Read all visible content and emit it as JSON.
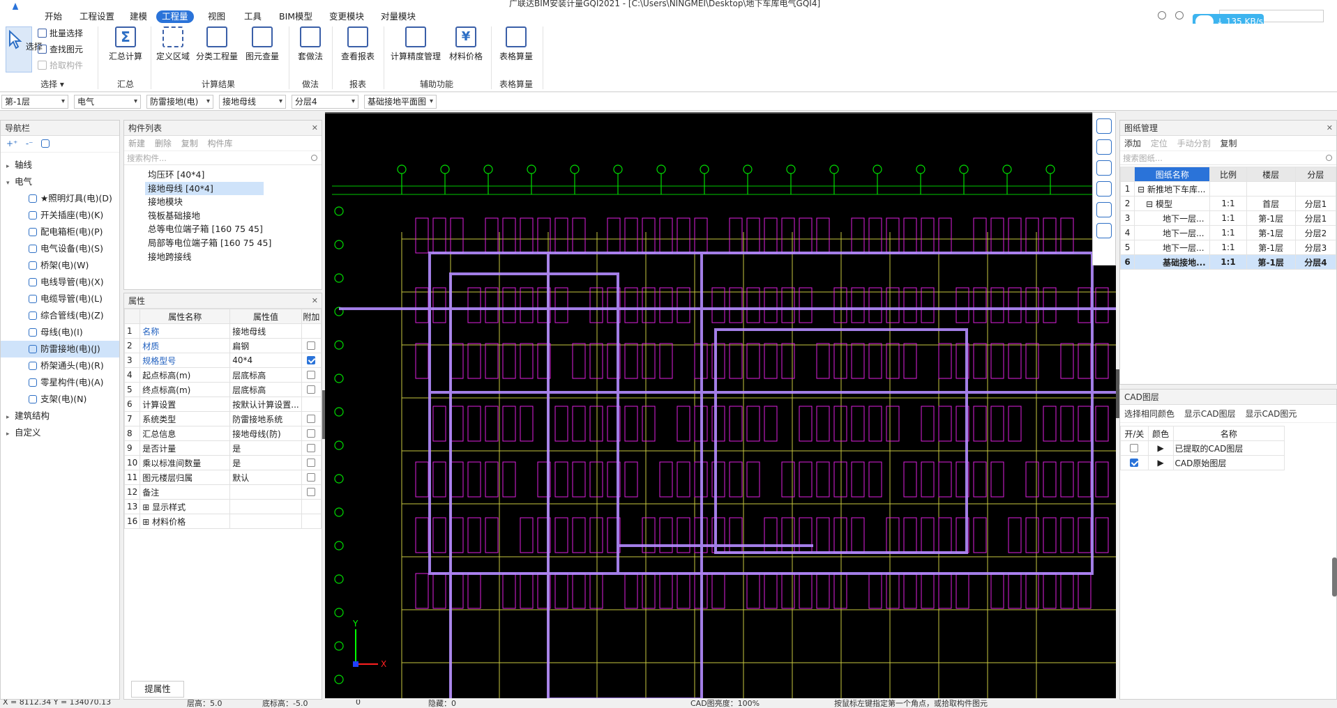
{
  "title": "广联达BIM安装计量GQI2021 - [C:\\Users\\NINGMEI\\Desktop\\地下车库电气GQI4]",
  "menus": [
    "开始",
    "工程设置",
    "建模",
    "工程量",
    "视图",
    "工具",
    "BIM模型",
    "变更模块",
    "对量模块"
  ],
  "active_menu": "工程量",
  "net_speed": "↓ 135 KB/s",
  "ribbon": {
    "select": "选择",
    "batch_select": "批量选择",
    "find_element": "查找图元",
    "pick_component": "拾取构件",
    "sum_calc": "汇总计算",
    "define_region": "定义区域",
    "sub_quantity": "分类工程量",
    "element_check": "图元查量",
    "apply_method": "套做法",
    "view_report": "查看报表",
    "precision_mgmt": "计算精度管理",
    "material_price": "材料价格",
    "table_calc": "表格算量",
    "groups": {
      "select": "选择",
      "summary": "汇总",
      "results": "计算结果",
      "method": "做法",
      "report": "报表",
      "aux": "辅助功能",
      "table": "表格算量"
    }
  },
  "selectors": [
    "第-1层",
    "电气",
    "防雷接地(电)",
    "接地母线",
    "分层4",
    "基础接地平面图"
  ],
  "nav": {
    "title": "导航栏",
    "items": [
      {
        "label": "轴线",
        "level": 0,
        "tri": "▸"
      },
      {
        "label": "电气",
        "level": 0,
        "tri": "▾"
      },
      {
        "label": "★照明灯具(电)(D)",
        "level": 1
      },
      {
        "label": "开关插座(电)(K)",
        "level": 1
      },
      {
        "label": "配电箱柜(电)(P)",
        "level": 1
      },
      {
        "label": "电气设备(电)(S)",
        "level": 1
      },
      {
        "label": "桥架(电)(W)",
        "level": 1
      },
      {
        "label": "电线导管(电)(X)",
        "level": 1
      },
      {
        "label": "电缆导管(电)(L)",
        "level": 1
      },
      {
        "label": "综合管线(电)(Z)",
        "level": 1
      },
      {
        "label": "母线(电)(I)",
        "level": 1
      },
      {
        "label": "防雷接地(电)(J)",
        "level": 1,
        "selected": true
      },
      {
        "label": "桥架通头(电)(R)",
        "level": 1
      },
      {
        "label": "零星构件(电)(A)",
        "level": 1
      },
      {
        "label": "支架(电)(N)",
        "level": 1
      },
      {
        "label": "建筑结构",
        "level": 0,
        "tri": "▸"
      },
      {
        "label": "自定义",
        "level": 0,
        "tri": "▸"
      }
    ]
  },
  "components": {
    "title": "构件列表",
    "toolbar": [
      "新建",
      "删除",
      "复制",
      "构件库"
    ],
    "search_placeholder": "搜索构件...",
    "items": [
      "均压环 [40*4]",
      "接地母线 [40*4]",
      "接地模块",
      "筏板基础接地",
      "总等电位端子箱 [160 75 45]",
      "局部等电位端子箱 [160 75 45]",
      "接地跨接线"
    ],
    "selected_index": 1
  },
  "properties": {
    "title": "属性",
    "headers": [
      "属性名称",
      "属性值",
      "附加"
    ],
    "rows": [
      {
        "no": "1",
        "name": "名称",
        "value": "接地母线",
        "blue": true,
        "cb": null
      },
      {
        "no": "2",
        "name": "材质",
        "value": "扁钢",
        "blue": true,
        "cb": false
      },
      {
        "no": "3",
        "name": "规格型号",
        "value": "40*4",
        "blue": true,
        "cb": true
      },
      {
        "no": "4",
        "name": "起点标高(m)",
        "value": "层底标高",
        "cb": false
      },
      {
        "no": "5",
        "name": "终点标高(m)",
        "value": "层底标高",
        "cb": false
      },
      {
        "no": "6",
        "name": "计算设置",
        "value": "按默认计算设置...",
        "cb": null
      },
      {
        "no": "7",
        "name": "系统类型",
        "value": "防雷接地系统",
        "cb": false
      },
      {
        "no": "8",
        "name": "汇总信息",
        "value": "接地母线(防)",
        "cb": false
      },
      {
        "no": "9",
        "name": "是否计量",
        "value": "是",
        "cb": false
      },
      {
        "no": "10",
        "name": "乘以标准间数量",
        "value": "是",
        "cb": false
      },
      {
        "no": "11",
        "name": "图元楼层归属",
        "value": "默认",
        "cb": false
      },
      {
        "no": "12",
        "name": "备注",
        "value": "",
        "cb": false
      },
      {
        "no": "13",
        "name": "显示样式",
        "value": "",
        "expand": true
      },
      {
        "no": "16",
        "name": "材料价格",
        "value": "",
        "expand": true
      }
    ],
    "extract_button": "提属性"
  },
  "drawings": {
    "title": "图纸管理",
    "toolbar": [
      "添加",
      "定位",
      "手动分割",
      "复制"
    ],
    "search_placeholder": "搜索图纸...",
    "headers": [
      "图纸名称",
      "比例",
      "楼层",
      "分层"
    ],
    "rows": [
      {
        "no": "1",
        "name": "新推地下车库...",
        "ratio": "",
        "floor": "",
        "layer": "",
        "tree": "⊟"
      },
      {
        "no": "2",
        "name": "模型",
        "ratio": "1:1",
        "floor": "首层",
        "layer": "分层1",
        "tree": "⊟"
      },
      {
        "no": "3",
        "name": "地下一层...",
        "ratio": "1:1",
        "floor": "第-1层",
        "layer": "分层1"
      },
      {
        "no": "4",
        "name": "地下一层...",
        "ratio": "1:1",
        "floor": "第-1层",
        "layer": "分层2"
      },
      {
        "no": "5",
        "name": "地下一层...",
        "ratio": "1:1",
        "floor": "第-1层",
        "layer": "分层3"
      },
      {
        "no": "6",
        "name": "基础接地...",
        "ratio": "1:1",
        "floor": "第-1层",
        "layer": "分层4",
        "selected": true
      }
    ]
  },
  "cad_layers": {
    "title": "CAD图层",
    "toolbar": [
      "选择相同颜色",
      "显示CAD图层",
      "显示CAD图元"
    ],
    "headers": [
      "开/关",
      "颜色",
      "名称"
    ],
    "rows": [
      {
        "name": "已提取的CAD图层",
        "on": false
      },
      {
        "name": "CAD原始图层",
        "on": true
      }
    ]
  },
  "status": {
    "coords": "X = 8112.34 Y = 134070.13",
    "floor_height": "层高：5.0",
    "base_height": "底标高：-5.0",
    "zero": "0",
    "hidden": "隐藏：0",
    "cad_brightness": "CAD图亮度：100%",
    "hint": "按鼠标左键指定第一个角点，或拾取构件图元"
  }
}
